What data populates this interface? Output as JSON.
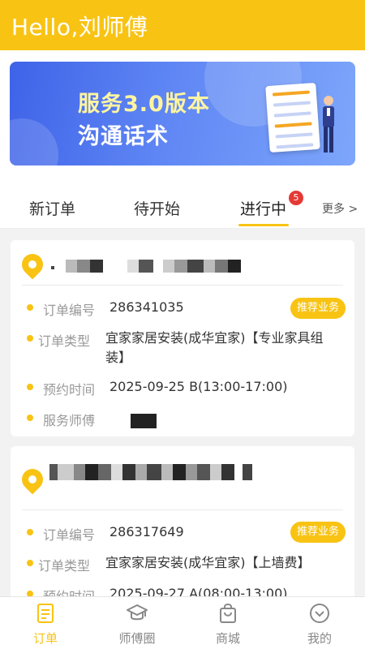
{
  "header": {
    "title": "Hello,刘师傅"
  },
  "banner": {
    "line1": "服务3.0版本",
    "line2": "沟通话术"
  },
  "tabs": [
    {
      "label": "新订单"
    },
    {
      "label": "待开始"
    },
    {
      "label": "进行中",
      "badge": "5"
    }
  ],
  "more": "更多 >",
  "orders": [
    {
      "order_no_label": "订单编号",
      "order_no": "286341035",
      "tag": "推荐业务",
      "type_label": "订单类型",
      "type_value_line1": "宜家家居安装(成华宜家)【专业家具组",
      "type_value_line2": "装】",
      "time_label": "预约时间",
      "time_value": "2025-09-25 B(13:00-17:00)",
      "worker_label": "服务师傅"
    },
    {
      "order_no_label": "订单编号",
      "order_no": "286317649",
      "tag": "推荐业务",
      "type_label": "订单类型",
      "type_value_line1": "宜家家居安装(成华宜家)【上墙费】",
      "time_label": "预约时间",
      "time_value": "2025-09-27 A(08:00-13:00)"
    }
  ],
  "tabbar": [
    {
      "label": "订单",
      "icon": "order-icon",
      "active": true
    },
    {
      "label": "师傅圈",
      "icon": "graduation-cap-icon"
    },
    {
      "label": "商城",
      "icon": "shopping-bag-icon"
    },
    {
      "label": "我的",
      "icon": "profile-icon"
    }
  ],
  "colors": {
    "brand": "#f8c313",
    "badge": "#e53935",
    "banner_blue": "#4a6ff0"
  }
}
